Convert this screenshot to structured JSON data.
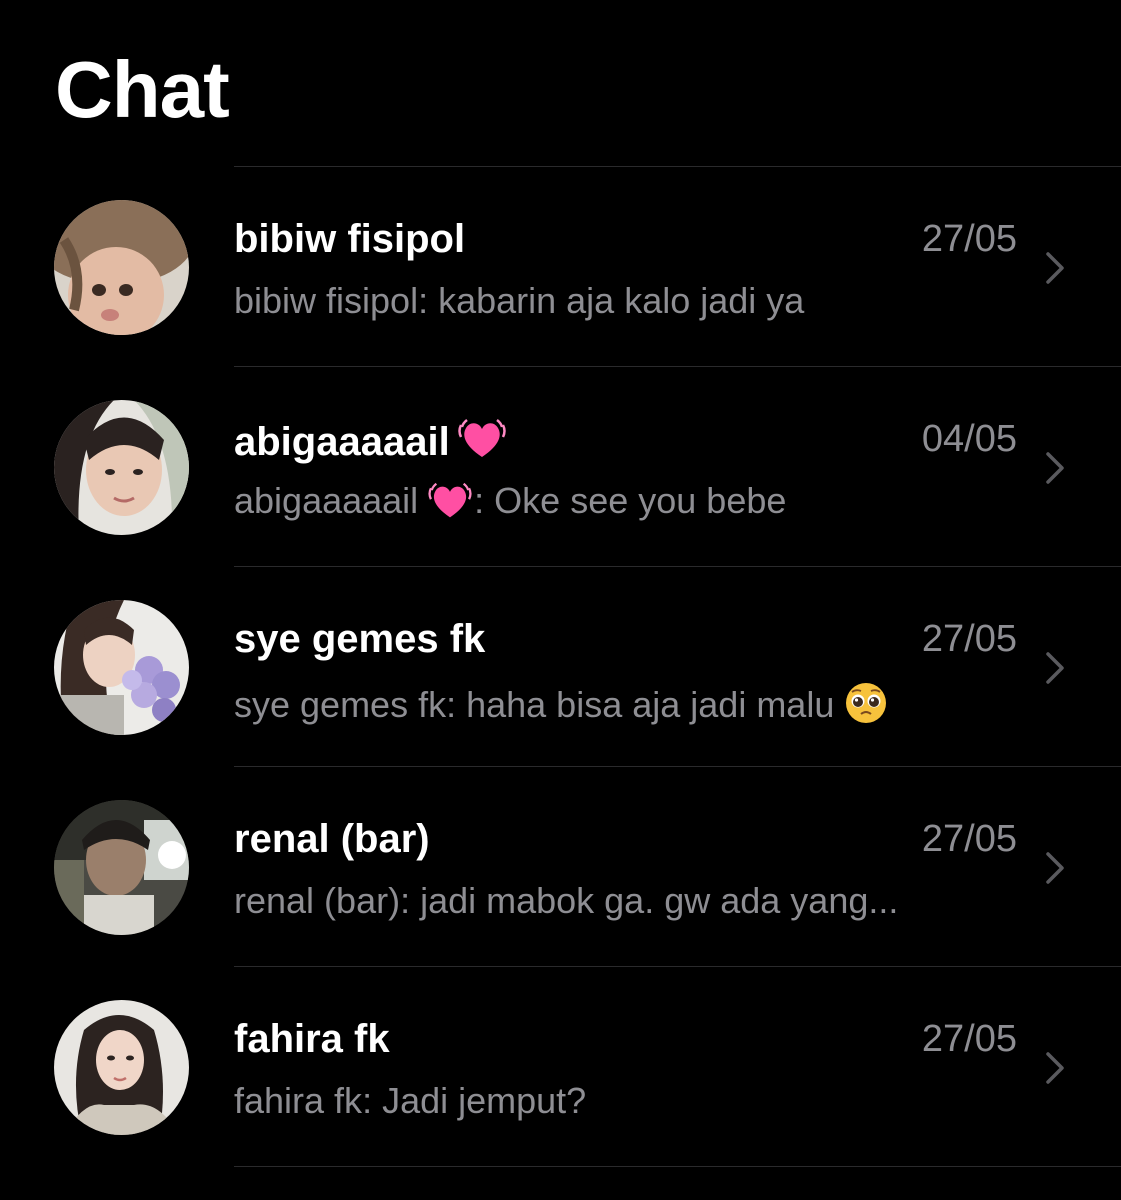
{
  "header": {
    "title": "Chat"
  },
  "chats": [
    {
      "name": "bibiw fisipol",
      "date": "27/05",
      "preview_sender": "bibiw fisipol",
      "preview_text": ": kabarin aja kalo jadi ya",
      "avatar_icon": "profile-photo",
      "name_emoji": "",
      "preview_emoji": ""
    },
    {
      "name": "abigaaaaail",
      "date": "04/05",
      "preview_sender": "abigaaaaail",
      "preview_text": ": Oke see you bebe",
      "avatar_icon": "profile-photo",
      "name_emoji": "pulsing-heart-icon",
      "preview_emoji": "pulsing-heart-icon"
    },
    {
      "name": "sye gemes fk",
      "date": "27/05",
      "preview_sender": "sye gemes fk",
      "preview_text": ": haha bisa aja jadi malu",
      "avatar_icon": "profile-photo",
      "name_emoji": "",
      "preview_emoji": "pleading-face-icon"
    },
    {
      "name": "renal (bar)",
      "date": "27/05",
      "preview_sender": "renal (bar)",
      "preview_text": ": jadi mabok ga. gw ada yang...",
      "avatar_icon": "profile-photo",
      "name_emoji": "",
      "preview_emoji": ""
    },
    {
      "name": "fahira fk",
      "date": "27/05",
      "preview_sender": "fahira fk",
      "preview_text": ": Jadi jemput?",
      "avatar_icon": "profile-photo",
      "name_emoji": "",
      "preview_emoji": ""
    }
  ],
  "colors": {
    "background": "#000000",
    "primary_text": "#ffffff",
    "secondary_text": "#8e8e93",
    "divider": "#2a2a2c",
    "heart": "#ff4fa3"
  }
}
